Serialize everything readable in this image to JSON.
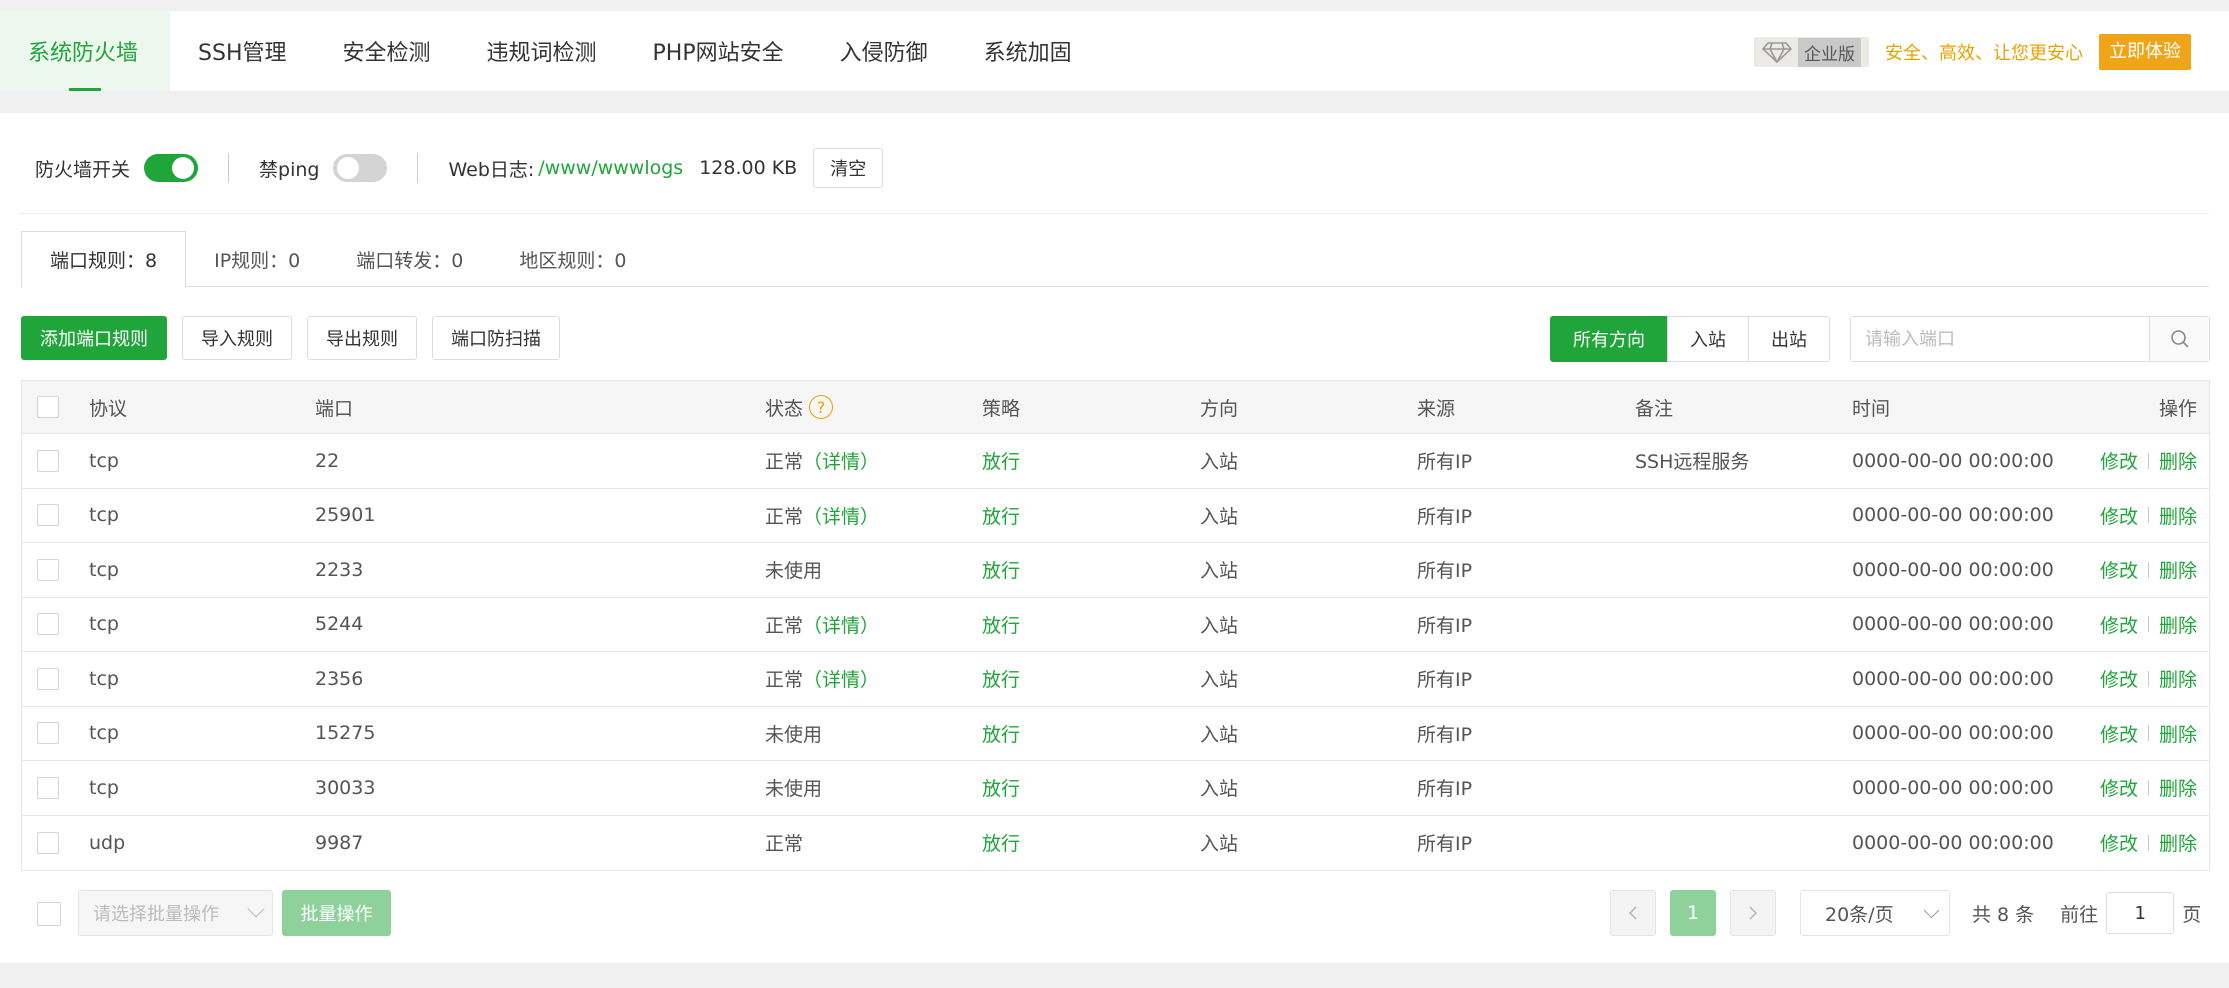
{
  "nav": {
    "tabs": [
      {
        "label": "系统防火墙"
      },
      {
        "label": "SSH管理"
      },
      {
        "label": "安全检测"
      },
      {
        "label": "违规词检测"
      },
      {
        "label": "PHP网站安全"
      },
      {
        "label": "入侵防御"
      },
      {
        "label": "系统加固"
      }
    ],
    "edition_badge": "企业版",
    "promo_text": "安全、高效、让您更安心",
    "try_button": "立即体验"
  },
  "toolbar": {
    "firewall_label": "防火墙开关",
    "firewall_on": true,
    "ping_label": "禁ping",
    "ping_on": false,
    "weblog_label": "Web日志:",
    "weblog_path": "/www/wwwlogs",
    "weblog_size": "128.00 KB",
    "clear_button": "清空"
  },
  "subtabs": [
    {
      "label": "端口规则：8"
    },
    {
      "label": "IP规则：0"
    },
    {
      "label": "端口转发：0"
    },
    {
      "label": "地区规则：0"
    }
  ],
  "actions": {
    "add_rule": "添加端口规则",
    "import_rule": "导入规则",
    "export_rule": "导出规则",
    "anti_scan": "端口防扫描"
  },
  "direction_filter": {
    "all": "所有方向",
    "inbound": "入站",
    "outbound": "出站"
  },
  "search": {
    "placeholder": "请输入端口"
  },
  "table": {
    "headers": {
      "protocol": "协议",
      "port": "端口",
      "status": "状态",
      "policy": "策略",
      "direction": "方向",
      "source": "来源",
      "note": "备注",
      "time": "时间",
      "ops": "操作"
    },
    "rows": [
      {
        "protocol": "tcp",
        "port": "22",
        "status": "正常",
        "detail": "（详情）",
        "policy": "放行",
        "direction": "入站",
        "source": "所有IP",
        "note": "SSH远程服务",
        "time": "0000-00-00 00:00:00",
        "edit": "修改",
        "del": "删除"
      },
      {
        "protocol": "tcp",
        "port": "25901",
        "status": "正常",
        "detail": "（详情）",
        "policy": "放行",
        "direction": "入站",
        "source": "所有IP",
        "note": "",
        "time": "0000-00-00 00:00:00",
        "edit": "修改",
        "del": "删除"
      },
      {
        "protocol": "tcp",
        "port": "2233",
        "status": "未使用",
        "detail": "",
        "policy": "放行",
        "direction": "入站",
        "source": "所有IP",
        "note": "",
        "time": "0000-00-00 00:00:00",
        "edit": "修改",
        "del": "删除"
      },
      {
        "protocol": "tcp",
        "port": "5244",
        "status": "正常",
        "detail": "（详情）",
        "policy": "放行",
        "direction": "入站",
        "source": "所有IP",
        "note": "",
        "time": "0000-00-00 00:00:00",
        "edit": "修改",
        "del": "删除"
      },
      {
        "protocol": "tcp",
        "port": "2356",
        "status": "正常",
        "detail": "（详情）",
        "policy": "放行",
        "direction": "入站",
        "source": "所有IP",
        "note": "",
        "time": "0000-00-00 00:00:00",
        "edit": "修改",
        "del": "删除"
      },
      {
        "protocol": "tcp",
        "port": "15275",
        "status": "未使用",
        "detail": "",
        "policy": "放行",
        "direction": "入站",
        "source": "所有IP",
        "note": "",
        "time": "0000-00-00 00:00:00",
        "edit": "修改",
        "del": "删除"
      },
      {
        "protocol": "tcp",
        "port": "30033",
        "status": "未使用",
        "detail": "",
        "policy": "放行",
        "direction": "入站",
        "source": "所有IP",
        "note": "",
        "time": "0000-00-00 00:00:00",
        "edit": "修改",
        "del": "删除"
      },
      {
        "protocol": "udp",
        "port": "9987",
        "status": "正常",
        "detail": "",
        "policy": "放行",
        "direction": "入站",
        "source": "所有IP",
        "note": "",
        "time": "0000-00-00 00:00:00",
        "edit": "修改",
        "del": "删除"
      }
    ]
  },
  "footer": {
    "batch_placeholder": "请选择批量操作",
    "batch_button": "批量操作",
    "prev_icon": "chevron-left-icon",
    "current_page": "1",
    "next_icon": "chevron-right-icon",
    "page_size": "20条/页",
    "total": "共 8 条",
    "goto_label": "前往",
    "goto_value": "1",
    "page_suffix": "页"
  },
  "colors": {
    "accent": "#20a53a",
    "promo": "#f0a519",
    "warning": "#e8a200"
  }
}
